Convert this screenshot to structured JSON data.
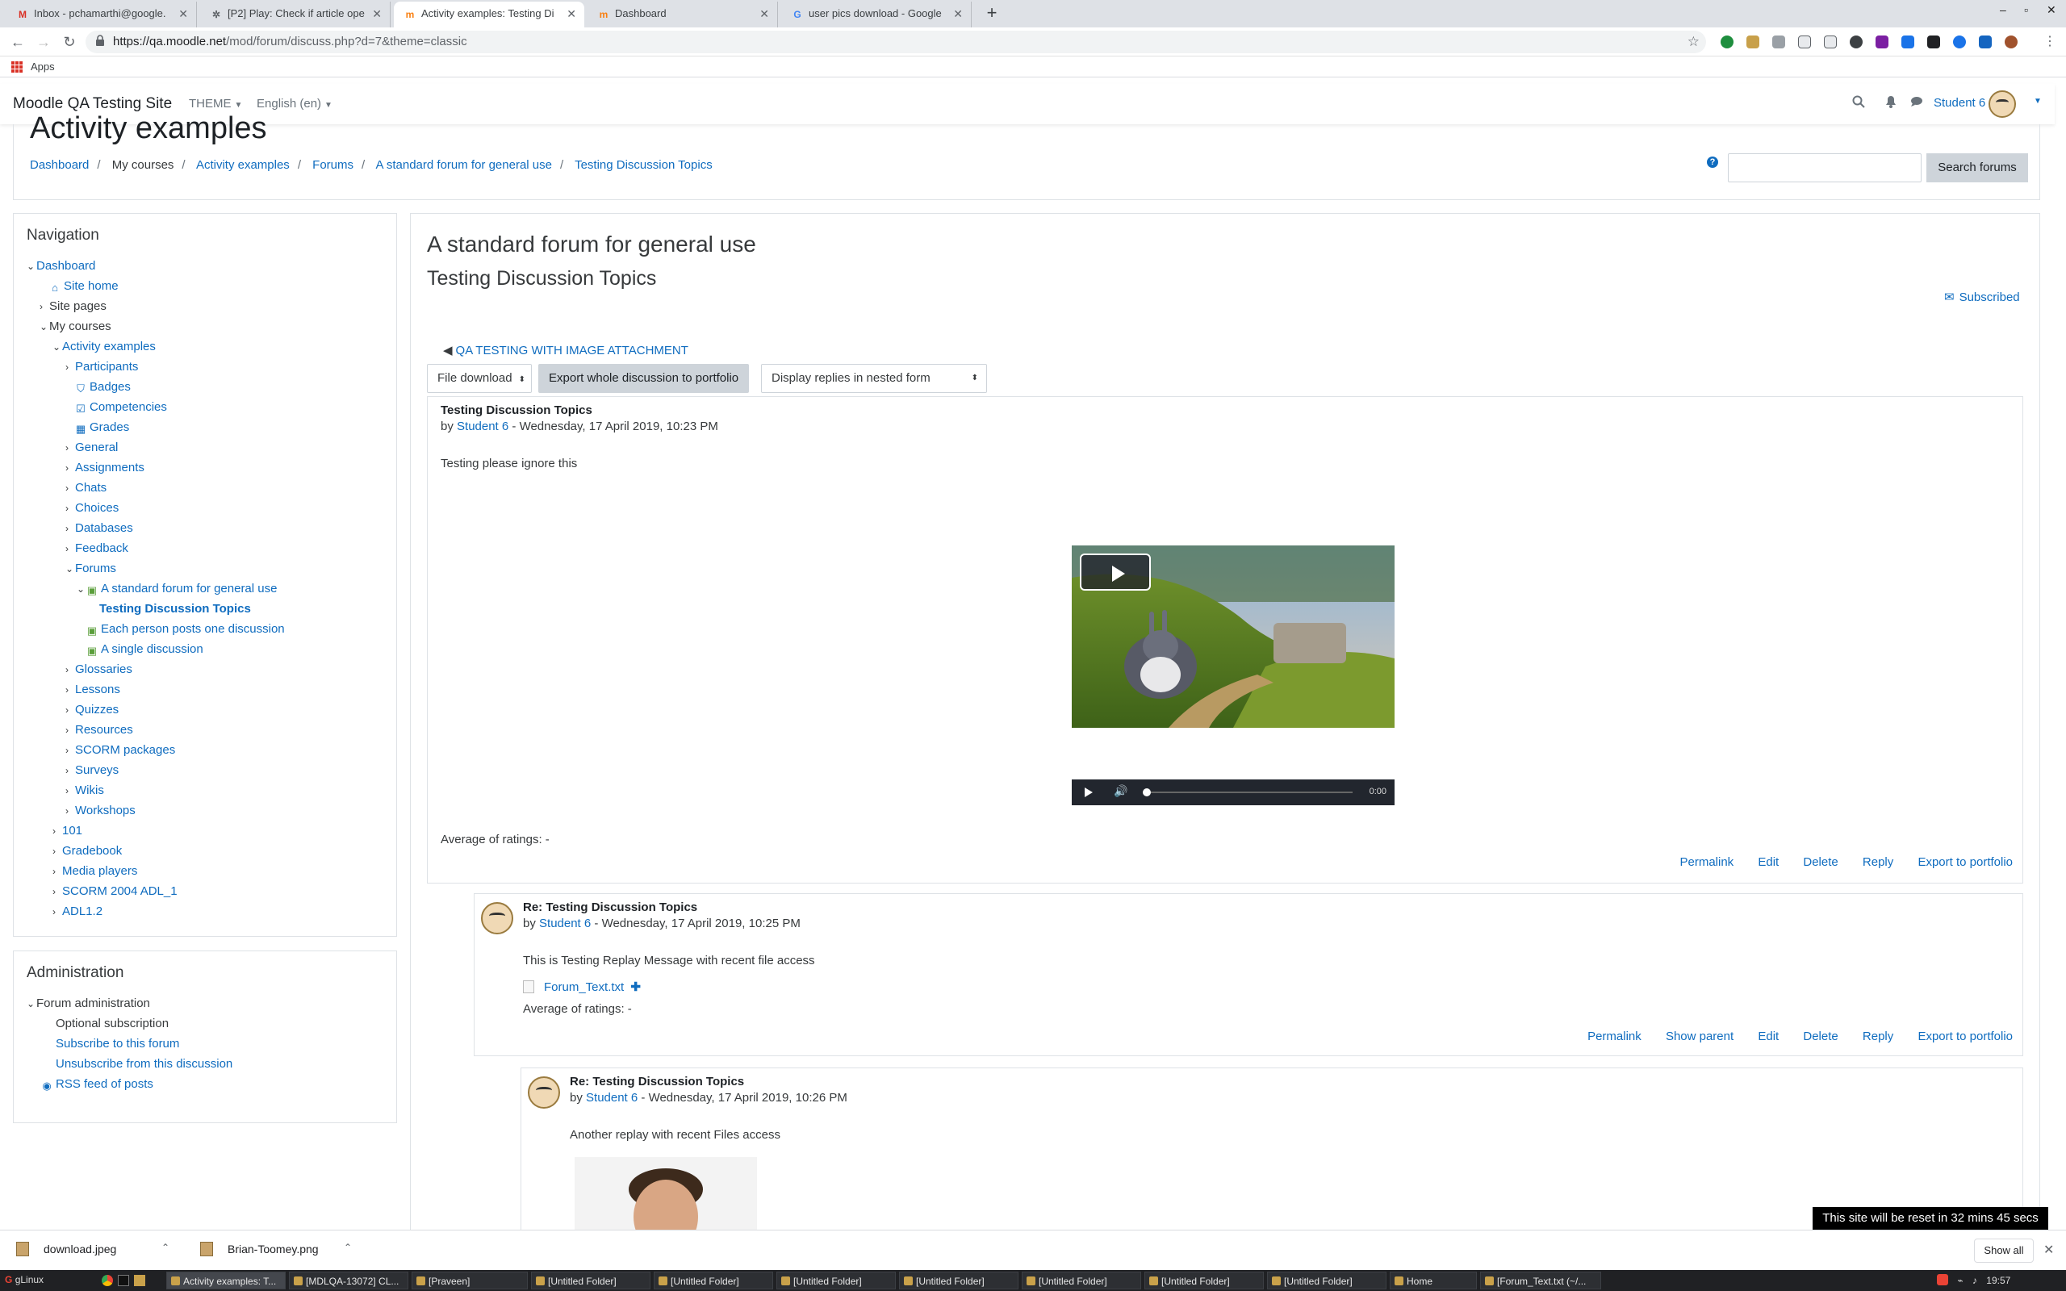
{
  "browser": {
    "tabs": [
      {
        "label": "Inbox - pchamarthi@google.",
        "icon": "gmail-icon",
        "active": false
      },
      {
        "label": "[P2] Play: Check if article ope",
        "icon": "bug-icon",
        "active": false
      },
      {
        "label": "Activity examples: Testing Di",
        "icon": "moodle-icon",
        "active": true
      },
      {
        "label": "Dashboard",
        "icon": "moodle-icon",
        "active": false
      },
      {
        "label": "user pics download - Google",
        "icon": "google-icon",
        "active": false
      }
    ],
    "new_tab": "+",
    "url_host": "https://qa.moodle.net",
    "url_path": "/mod/forum/discuss.php?d=7&theme=classic",
    "bookmarks_apps": "Apps"
  },
  "moodle": {
    "brand": "Moodle QA Testing Site",
    "theme_menu": "THEME",
    "language_menu": "English (en)",
    "user_name": "Student 6"
  },
  "page": {
    "heading": "Activity examples",
    "breadcrumb": [
      "Dashboard",
      "My courses",
      "Activity examples",
      "Forums",
      "A standard forum for general use",
      "Testing Discussion Topics"
    ],
    "search_button": "Search forums",
    "help": "?"
  },
  "navigation": {
    "title": "Navigation",
    "items": [
      {
        "label": "Dashboard",
        "level": 0,
        "chev": "v",
        "link": true,
        "icon": ""
      },
      {
        "label": "Site home",
        "level": 1,
        "chev": "",
        "link": true,
        "icon": "home-icon"
      },
      {
        "label": "Site pages",
        "level": 1,
        "chev": ">",
        "link": false,
        "icon": ""
      },
      {
        "label": "My courses",
        "level": 1,
        "chev": "v",
        "link": false,
        "icon": ""
      },
      {
        "label": "Activity examples",
        "level": 2,
        "chev": "v",
        "link": true,
        "icon": ""
      },
      {
        "label": "Participants",
        "level": 3,
        "chev": ">",
        "link": true,
        "icon": ""
      },
      {
        "label": "Badges",
        "level": 3,
        "chev": "",
        "link": true,
        "icon": "badge-icon"
      },
      {
        "label": "Competencies",
        "level": 3,
        "chev": "",
        "link": true,
        "icon": "check-square-icon"
      },
      {
        "label": "Grades",
        "level": 3,
        "chev": "",
        "link": true,
        "icon": "table-icon"
      },
      {
        "label": "General",
        "level": 3,
        "chev": ">",
        "link": true,
        "icon": ""
      },
      {
        "label": "Assignments",
        "level": 3,
        "chev": ">",
        "link": true,
        "icon": ""
      },
      {
        "label": "Chats",
        "level": 3,
        "chev": ">",
        "link": true,
        "icon": ""
      },
      {
        "label": "Choices",
        "level": 3,
        "chev": ">",
        "link": true,
        "icon": ""
      },
      {
        "label": "Databases",
        "level": 3,
        "chev": ">",
        "link": true,
        "icon": ""
      },
      {
        "label": "Feedback",
        "level": 3,
        "chev": ">",
        "link": true,
        "icon": ""
      },
      {
        "label": "Forums",
        "level": 3,
        "chev": "v",
        "link": true,
        "icon": ""
      },
      {
        "label": "A standard forum for general use",
        "level": 4,
        "chev": "v",
        "link": true,
        "icon": "forum-icon"
      },
      {
        "label": "Testing Discussion Topics",
        "level": 5,
        "chev": "",
        "link": true,
        "icon": "",
        "bold": true
      },
      {
        "label": "Each person posts one discussion",
        "level": 4,
        "chev": "",
        "link": true,
        "icon": "forum-icon"
      },
      {
        "label": "A single discussion",
        "level": 4,
        "chev": "",
        "link": true,
        "icon": "forum-icon"
      },
      {
        "label": "Glossaries",
        "level": 3,
        "chev": ">",
        "link": true,
        "icon": ""
      },
      {
        "label": "Lessons",
        "level": 3,
        "chev": ">",
        "link": true,
        "icon": ""
      },
      {
        "label": "Quizzes",
        "level": 3,
        "chev": ">",
        "link": true,
        "icon": ""
      },
      {
        "label": "Resources",
        "level": 3,
        "chev": ">",
        "link": true,
        "icon": ""
      },
      {
        "label": "SCORM packages",
        "level": 3,
        "chev": ">",
        "link": true,
        "icon": ""
      },
      {
        "label": "Surveys",
        "level": 3,
        "chev": ">",
        "link": true,
        "icon": ""
      },
      {
        "label": "Wikis",
        "level": 3,
        "chev": ">",
        "link": true,
        "icon": ""
      },
      {
        "label": "Workshops",
        "level": 3,
        "chev": ">",
        "link": true,
        "icon": ""
      },
      {
        "label": "101",
        "level": 2,
        "chev": ">",
        "link": true,
        "icon": ""
      },
      {
        "label": "Gradebook",
        "level": 2,
        "chev": ">",
        "link": true,
        "icon": ""
      },
      {
        "label": "Media players",
        "level": 2,
        "chev": ">",
        "link": true,
        "icon": ""
      },
      {
        "label": "SCORM 2004 ADL_1",
        "level": 2,
        "chev": ">",
        "link": true,
        "icon": ""
      },
      {
        "label": "ADL1.2",
        "level": 2,
        "chev": ">",
        "link": true,
        "icon": ""
      }
    ]
  },
  "administration": {
    "title": "Administration",
    "forum_admin": "Forum administration",
    "items": [
      {
        "label": "Optional subscription",
        "link": false,
        "icon": ""
      },
      {
        "label": "Subscribe to this forum",
        "link": true,
        "icon": ""
      },
      {
        "label": "Unsubscribe from this discussion",
        "link": true,
        "icon": ""
      },
      {
        "label": "RSS feed of posts",
        "link": true,
        "icon": "rss-icon"
      }
    ]
  },
  "forum": {
    "title": "A standard forum for general use",
    "discussion": "Testing Discussion Topics",
    "subscribed": "Subscribed",
    "prev_discussion": "QA TESTING WITH IMAGE ATTACHMENT",
    "portfolio_select": "File download",
    "export_button": "Export whole discussion to portfolio",
    "display_mode": "Display replies in nested form",
    "posts": [
      {
        "subject": "Testing Discussion Topics",
        "by": "by",
        "author": "Student 6",
        "date": "- Wednesday, 17 April 2019, 10:23 PM",
        "message": "Testing please ignore this",
        "rating": "Average of ratings: -",
        "commands": [
          "Permalink",
          "Edit",
          "Delete",
          "Reply",
          "Export to portfolio"
        ]
      },
      {
        "subject": "Re: Testing Discussion Topics",
        "by": "by",
        "author": "Student 6",
        "date": "- Wednesday, 17 April 2019, 10:25 PM",
        "message": "This is Testing Replay Message with recent file access",
        "attachment": "Forum_Text.txt",
        "rating": "Average of ratings: -",
        "commands": [
          "Permalink",
          "Show parent",
          "Edit",
          "Delete",
          "Reply",
          "Export to portfolio"
        ]
      },
      {
        "subject": "Re: Testing Discussion Topics",
        "by": "by",
        "author": "Student 6",
        "date": "- Wednesday, 17 April 2019, 10:26 PM",
        "message": "Another replay with recent Files access"
      }
    ],
    "audio_time": "0:00"
  },
  "toast": "This site will be reset in 32 mins 45 secs",
  "downloads": {
    "items": [
      "download.jpeg",
      "Brian-Toomey.png"
    ],
    "show_all": "Show all"
  },
  "taskbar": {
    "start": "gLinux",
    "tasks": [
      "Activity examples: T...",
      "[MDLQA-13072] CL...",
      "[Praveen]",
      "[Untitled Folder]",
      "[Untitled Folder]",
      "[Untitled Folder]",
      "[Untitled Folder]",
      "[Untitled Folder]",
      "[Untitled Folder]",
      "[Untitled Folder]",
      "Home",
      "[Forum_Text.txt (~/..."
    ],
    "clock": "19:57"
  }
}
